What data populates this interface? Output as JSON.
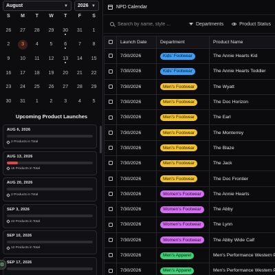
{
  "app": {
    "title": "NPD Calendar",
    "calendar_icon": "calendar-icon"
  },
  "calendar": {
    "month": "August",
    "year": "2026",
    "weekdays": [
      "S",
      "M",
      "T",
      "W",
      "T",
      "F",
      "S"
    ],
    "weeks": [
      [
        {
          "d": "26"
        },
        {
          "d": "27"
        },
        {
          "d": "28"
        },
        {
          "d": "29"
        },
        {
          "d": "30",
          "dot": true
        },
        {
          "d": "31"
        },
        {
          "d": "1"
        }
      ],
      [
        {
          "d": "2"
        },
        {
          "d": "3",
          "today": true
        },
        {
          "d": "4"
        },
        {
          "d": "5"
        },
        {
          "d": "6",
          "dot": true
        },
        {
          "d": "7"
        },
        {
          "d": "8"
        }
      ],
      [
        {
          "d": "9"
        },
        {
          "d": "10"
        },
        {
          "d": "11"
        },
        {
          "d": "12"
        },
        {
          "d": "13",
          "dot": true
        },
        {
          "d": "14"
        },
        {
          "d": "15"
        }
      ],
      [
        {
          "d": "16"
        },
        {
          "d": "17"
        },
        {
          "d": "18"
        },
        {
          "d": "19"
        },
        {
          "d": "20"
        },
        {
          "d": "21"
        },
        {
          "d": "22"
        }
      ],
      [
        {
          "d": "23"
        },
        {
          "d": "24"
        },
        {
          "d": "25"
        },
        {
          "d": "26"
        },
        {
          "d": "27"
        },
        {
          "d": "28"
        },
        {
          "d": "29"
        }
      ],
      [
        {
          "d": "30"
        },
        {
          "d": "31"
        },
        {
          "d": "1"
        },
        {
          "d": "2"
        },
        {
          "d": "3"
        },
        {
          "d": "4"
        },
        {
          "d": "5"
        }
      ]
    ]
  },
  "launches": {
    "title": "Upcoming Product Launches",
    "items": [
      {
        "date": "AUG 6, 2026",
        "count": "2 Products in Total",
        "progress": 0
      },
      {
        "date": "AUG 13, 2026",
        "count": "15 Products in Total",
        "progress": 0.13
      },
      {
        "date": "AUG 20, 2026",
        "count": "2 Products in Total",
        "progress": 0
      },
      {
        "date": "SEP 3, 2026",
        "count": "43 Products in Total",
        "progress": 0
      },
      {
        "date": "SEP 10, 2026",
        "count": "12 Products in Total",
        "progress": 0
      },
      {
        "date": "SEP 17, 2026",
        "count": "",
        "progress": 0
      }
    ]
  },
  "search": {
    "placeholder": "Search by name, style ..."
  },
  "filters": {
    "department": "Departments",
    "status": "Product Status"
  },
  "table": {
    "headers": {
      "launch_date": "Launch Date",
      "department": "Department",
      "product_name": "Product Name"
    },
    "rows": [
      {
        "date": "7/30/2026",
        "dept": "Kids' Footwear",
        "dept_type": "kids",
        "name": "The Annie Hearts Kid"
      },
      {
        "date": "7/30/2026",
        "dept": "Kids' Footwear",
        "dept_type": "kids",
        "name": "The Annie Hearts Toddler"
      },
      {
        "date": "7/30/2026",
        "dept": "Men's Footwear",
        "dept_type": "mens",
        "name": "The Wyatt"
      },
      {
        "date": "7/30/2026",
        "dept": "Men's Footwear",
        "dept_type": "mens",
        "name": "The Doc Horizon"
      },
      {
        "date": "7/30/2026",
        "dept": "Men's Footwear",
        "dept_type": "mens",
        "name": "The Earl"
      },
      {
        "date": "7/30/2026",
        "dept": "Men's Footwear",
        "dept_type": "mens",
        "name": "The Monterrey"
      },
      {
        "date": "7/30/2026",
        "dept": "Men's Footwear",
        "dept_type": "mens",
        "name": "The Blaze"
      },
      {
        "date": "7/30/2026",
        "dept": "Men's Footwear",
        "dept_type": "mens",
        "name": "The Jack"
      },
      {
        "date": "7/30/2026",
        "dept": "Men's Footwear",
        "dept_type": "mens",
        "name": "The Doc Frontier"
      },
      {
        "date": "7/30/2026",
        "dept": "Women's Footwear",
        "dept_type": "womens",
        "name": "The Annie Hearts"
      },
      {
        "date": "7/30/2026",
        "dept": "Women's Footwear",
        "dept_type": "womens",
        "name": "The Abby"
      },
      {
        "date": "7/30/2026",
        "dept": "Women's Footwear",
        "dept_type": "womens",
        "name": "The Lynn"
      },
      {
        "date": "7/30/2026",
        "dept": "Women's Footwear",
        "dept_type": "womens",
        "name": "The Abby Wide Calf"
      },
      {
        "date": "7/30/2026",
        "dept": "Men's Apparel",
        "dept_type": "apparel",
        "name": "Men's Performance Western Pearl Snap"
      },
      {
        "date": "7/30/2026",
        "dept": "Men's Apparel",
        "dept_type": "apparel",
        "name": "Men's Performance Western Pearl"
      }
    ]
  },
  "colors": {
    "kids": "#3d9ef5",
    "mens": "#f2c230",
    "womens": "#d56ff2",
    "apparel": "#3fd07a",
    "accent": "#e04848"
  }
}
